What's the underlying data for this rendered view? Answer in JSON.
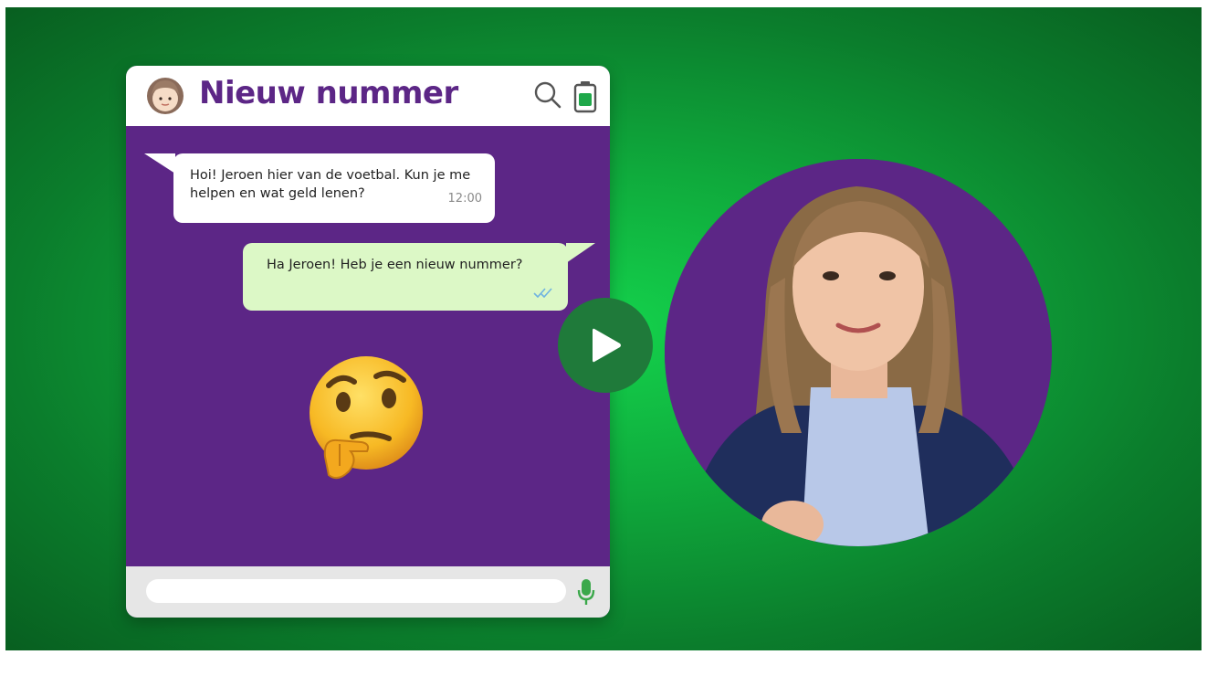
{
  "chat": {
    "title": "Nieuw nummer",
    "header_icons": [
      "avatar-emoji",
      "search-icon",
      "battery-icon"
    ],
    "messages": [
      {
        "direction": "incoming",
        "text": "Hoi! Jeroen hier van de voetbal. Kun je me helpen en wat geld lenen?",
        "time": "12:00"
      },
      {
        "direction": "outgoing",
        "text": "Ha Jeroen! Heb je een nieuw nummer?",
        "status": "read-ticks"
      }
    ],
    "sticker": "thinking-face-emoji",
    "input": {
      "value": "",
      "placeholder": ""
    },
    "mic_icon": "microphone-icon"
  },
  "video": {
    "play_icon": "play-icon",
    "presenter": "presenter-portrait"
  },
  "colors": {
    "background_green": "#10b83e",
    "chat_purple": "#5c2686",
    "outgoing_bubble": "#dcf8c6",
    "incoming_bubble": "#ffffff",
    "play_button": "#1f7a3a",
    "mic_green": "#3aa84a"
  }
}
